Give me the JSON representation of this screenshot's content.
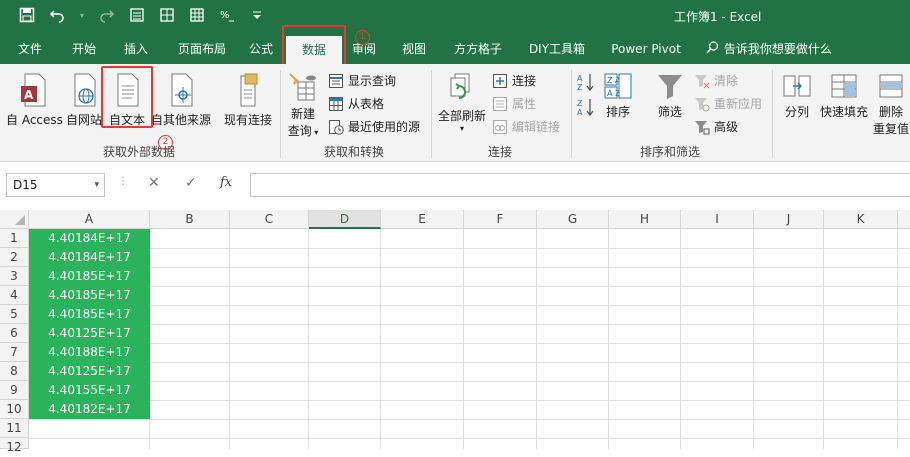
{
  "window": {
    "title": "工作簿1  -  Excel"
  },
  "quick_access": [
    "save-icon",
    "undo-icon",
    "redo-icon",
    "form-icon",
    "grid-icon",
    "table-icon",
    "format-painter-icon",
    "customize-icon"
  ],
  "tabs": [
    "文件",
    "开始",
    "插入",
    "页面布局",
    "公式",
    "数据",
    "审阅",
    "视图",
    "方方格子",
    "DIY工具箱",
    "Power Pivot"
  ],
  "active_tab": "数据",
  "tell_me": "告诉我你想要做什么",
  "annotations": {
    "step1": "1",
    "step2": "2"
  },
  "ribbon": {
    "get_external": {
      "name": "获取外部数据",
      "buttons": [
        "自 Access",
        "自网站",
        "自文本",
        "自其他来源",
        "现有连接"
      ]
    },
    "get_transform": {
      "name": "获取和转换",
      "new_query": [
        "新建",
        "查询"
      ],
      "items": [
        "显示查询",
        "从表格",
        "最近使用的源"
      ]
    },
    "connections": {
      "name": "连接",
      "refresh_all": "全部刷新",
      "items": [
        "连接",
        "属性",
        "编辑链接"
      ]
    },
    "sort_filter": {
      "name": "排序和筛选",
      "sort": "排序",
      "filter": "筛选",
      "items": [
        "清除",
        "重新应用",
        "高级"
      ]
    },
    "data_tools": {
      "split": "分列",
      "flash_fill": "快速填充",
      "remove_dup": [
        "删除",
        "重复值"
      ]
    }
  },
  "formula_bar": {
    "name_box": "D15",
    "fx": "fx",
    "formula": ""
  },
  "columns": [
    "A",
    "B",
    "C",
    "D",
    "E",
    "F",
    "G",
    "H",
    "I",
    "J",
    "K"
  ],
  "rows": [
    "1",
    "2",
    "3",
    "4",
    "5",
    "6",
    "7",
    "8",
    "9",
    "10",
    "11",
    "12"
  ],
  "cells_A": [
    "4.40184E+17",
    "4.40184E+17",
    "4.40185E+17",
    "4.40185E+17",
    "4.40185E+17",
    "4.40125E+17",
    "4.40188E+17",
    "4.40125E+17",
    "4.40155E+17",
    "4.40182E+17"
  ],
  "colors": {
    "excel_green": "#217346",
    "cell_fill": "#2bb35b",
    "highlight": "#e53a30"
  }
}
